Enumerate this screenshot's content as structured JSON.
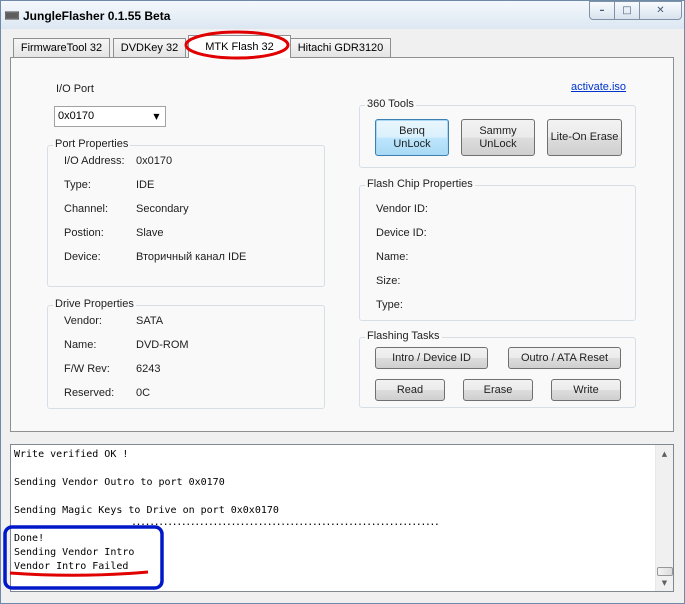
{
  "window": {
    "title": "JungleFlasher 0.1.55 Beta",
    "controls": {
      "minimize": "–",
      "maximize": "□",
      "close": "✕"
    }
  },
  "tabs": [
    {
      "label": "FirmwareTool 32",
      "active": false
    },
    {
      "label": "DVDKey 32",
      "active": false
    },
    {
      "label": "MTK Flash 32",
      "active": true
    },
    {
      "label": "Hitachi GDR3120",
      "active": false
    }
  ],
  "io_port": {
    "label": "I/O Port",
    "value": "0x0170"
  },
  "activate_link": "activate.iso",
  "port_properties": {
    "title": "Port Properties",
    "rows": [
      {
        "label": "I/O Address:",
        "value": "0x0170"
      },
      {
        "label": "Type:",
        "value": "IDE"
      },
      {
        "label": "Channel:",
        "value": "Secondary"
      },
      {
        "label": "Postion:",
        "value": "Slave"
      },
      {
        "label": "Device:",
        "value": "Вторичный канал IDE"
      }
    ]
  },
  "drive_properties": {
    "title": "Drive Properties",
    "rows": [
      {
        "label": "Vendor:",
        "value": "SATA"
      },
      {
        "label": "Name:",
        "value": "DVD-ROM"
      },
      {
        "label": "F/W Rev:",
        "value": "6243"
      },
      {
        "label": "Reserved:",
        "value": "0C"
      }
    ]
  },
  "tools_360": {
    "title": "360 Tools",
    "buttons": [
      "Benq\nUnLock",
      "Sammy\nUnLock",
      "Lite-On Erase"
    ]
  },
  "flash_chip": {
    "title": "Flash Chip Properties",
    "rows": [
      "Vendor ID:",
      "Device ID:",
      "Name:",
      "Size:",
      "Type:"
    ]
  },
  "flashing_tasks": {
    "title": "Flashing Tasks",
    "buttons": [
      "Intro / Device ID",
      "Outro / ATA Reset",
      "Read",
      "Erase",
      "Write"
    ]
  },
  "log": {
    "lines": [
      "Write verified OK !",
      "",
      "Sending Vendor Outro to port 0x0170",
      "",
      "Sending Magic Keys to Drive on port 0x0x0170",
      "....................................................................",
      "Done!",
      "Sending Vendor Intro",
      "Vendor Intro Failed"
    ]
  },
  "colors": {
    "annotation_red": "#e00000",
    "annotation_blue": "#0018c8",
    "link": "#0033cc"
  }
}
